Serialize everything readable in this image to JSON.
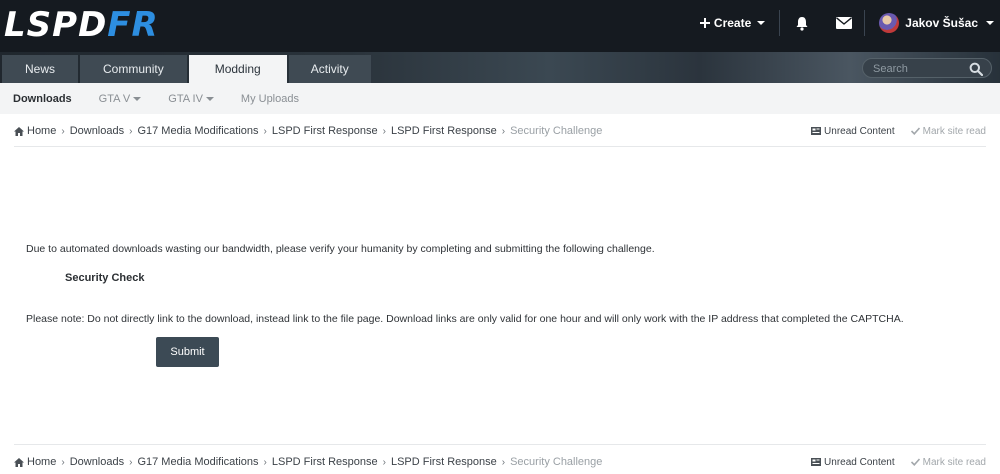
{
  "header": {
    "logo_left": "LSPD",
    "logo_right": "FR",
    "create_label": "Create",
    "notifications_icon": "bell-icon",
    "messages_icon": "envelope-icon",
    "user_name": "Jakov Šušac"
  },
  "primary_nav": {
    "tabs": [
      {
        "label": "News"
      },
      {
        "label": "Community"
      },
      {
        "label": "Modding"
      },
      {
        "label": "Activity"
      }
    ],
    "active_tab": "Modding",
    "search_placeholder": "Search"
  },
  "secondary_nav": {
    "items": [
      {
        "label": "Downloads"
      },
      {
        "label": "GTA V"
      },
      {
        "label": "GTA IV"
      },
      {
        "label": "My Uploads"
      }
    ]
  },
  "breadcrumb": {
    "items": [
      {
        "label": "Home"
      },
      {
        "label": "Downloads"
      },
      {
        "label": "G17 Media Modifications"
      },
      {
        "label": "LSPD First Response"
      },
      {
        "label": "LSPD First Response"
      },
      {
        "label": "Security Challenge"
      }
    ],
    "unread_label": "Unread Content",
    "mark_read_label": "Mark site read"
  },
  "main": {
    "notice": "Due to automated downloads wasting our bandwidth, please verify your humanity by completing and submitting the following challenge.",
    "security_heading": "Security Check",
    "please_note": "Please note: Do not directly link to the download, instead link to the file page. Download links are only valid for one hour and will only work with the IP address that completed the CAPTCHA.",
    "submit_label": "Submit"
  },
  "colors": {
    "header_bg": "#151a20",
    "logo_accent": "#2d8ee0",
    "button_bg": "#3c4a55"
  }
}
